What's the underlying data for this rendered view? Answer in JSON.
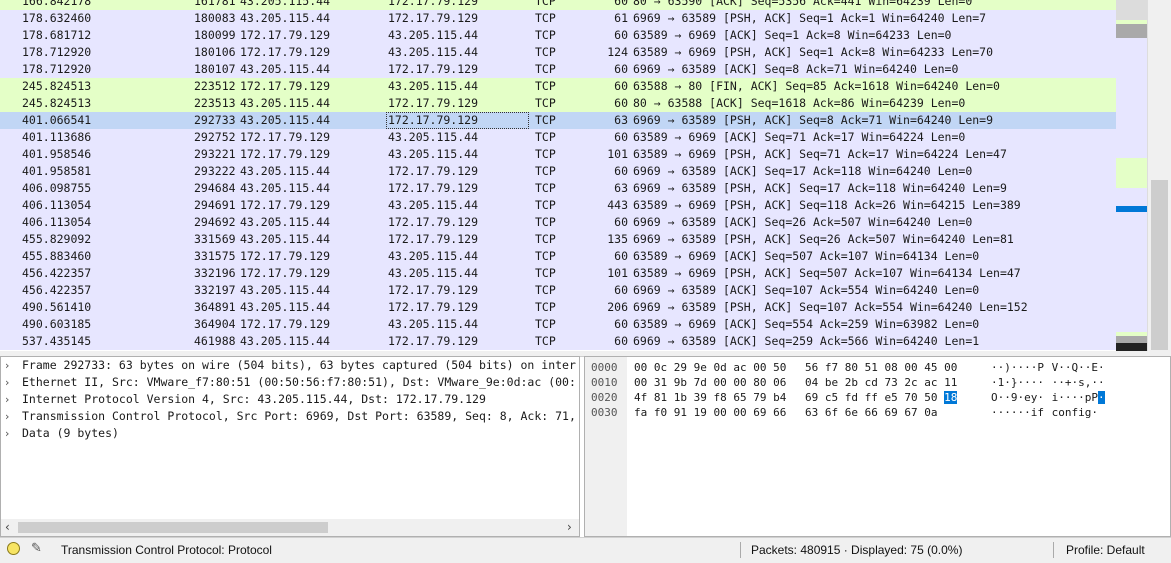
{
  "packet_list": {
    "rows": [
      {
        "time": "166.842178",
        "no": "161781",
        "src": "43.205.115.44",
        "dst": "172.17.79.129",
        "proto": "TCP",
        "len": "60",
        "info": "80 → 63590 [ACK] Seq=5356 Ack=441 Win=64239 Len=0",
        "color": "http"
      },
      {
        "time": "178.632460",
        "no": "180083",
        "src": "43.205.115.44",
        "dst": "172.17.79.129",
        "proto": "TCP",
        "len": "61",
        "info": "6969 → 63589 [PSH, ACK] Seq=1 Ack=1 Win=64240 Len=7",
        "color": "tcp"
      },
      {
        "time": "178.681712",
        "no": "180099",
        "src": "172.17.79.129",
        "dst": "43.205.115.44",
        "proto": "TCP",
        "len": "60",
        "info": "63589 → 6969 [ACK] Seq=1 Ack=8 Win=64233 Len=0",
        "color": "tcp"
      },
      {
        "time": "178.712920",
        "no": "180106",
        "src": "172.17.79.129",
        "dst": "43.205.115.44",
        "proto": "TCP",
        "len": "124",
        "info": "63589 → 6969 [PSH, ACK] Seq=1 Ack=8 Win=64233 Len=70",
        "color": "tcp"
      },
      {
        "time": "178.712920",
        "no": "180107",
        "src": "43.205.115.44",
        "dst": "172.17.79.129",
        "proto": "TCP",
        "len": "60",
        "info": "6969 → 63589 [ACK] Seq=8 Ack=71 Win=64240 Len=0",
        "color": "tcp"
      },
      {
        "time": "245.824513",
        "no": "223512",
        "src": "172.17.79.129",
        "dst": "43.205.115.44",
        "proto": "TCP",
        "len": "60",
        "info": "63588 → 80 [FIN, ACK] Seq=85 Ack=1618 Win=64240 Len=0",
        "color": "http"
      },
      {
        "time": "245.824513",
        "no": "223513",
        "src": "43.205.115.44",
        "dst": "172.17.79.129",
        "proto": "TCP",
        "len": "60",
        "info": "80 → 63588 [ACK] Seq=1618 Ack=86 Win=64239 Len=0",
        "color": "http"
      },
      {
        "time": "401.066541",
        "no": "292733",
        "src": "43.205.115.44",
        "dst": "172.17.79.129",
        "proto": "TCP",
        "len": "63",
        "info": "6969 → 63589 [PSH, ACK] Seq=8 Ack=71 Win=64240 Len=9",
        "color": "sel"
      },
      {
        "time": "401.113686",
        "no": "292752",
        "src": "172.17.79.129",
        "dst": "43.205.115.44",
        "proto": "TCP",
        "len": "60",
        "info": "63589 → 6969 [ACK] Seq=71 Ack=17 Win=64224 Len=0",
        "color": "tcp"
      },
      {
        "time": "401.958546",
        "no": "293221",
        "src": "172.17.79.129",
        "dst": "43.205.115.44",
        "proto": "TCP",
        "len": "101",
        "info": "63589 → 6969 [PSH, ACK] Seq=71 Ack=17 Win=64224 Len=47",
        "color": "tcp"
      },
      {
        "time": "401.958581",
        "no": "293222",
        "src": "43.205.115.44",
        "dst": "172.17.79.129",
        "proto": "TCP",
        "len": "60",
        "info": "6969 → 63589 [ACK] Seq=17 Ack=118 Win=64240 Len=0",
        "color": "tcp"
      },
      {
        "time": "406.098755",
        "no": "294684",
        "src": "43.205.115.44",
        "dst": "172.17.79.129",
        "proto": "TCP",
        "len": "63",
        "info": "6969 → 63589 [PSH, ACK] Seq=17 Ack=118 Win=64240 Len=9",
        "color": "tcp"
      },
      {
        "time": "406.113054",
        "no": "294691",
        "src": "172.17.79.129",
        "dst": "43.205.115.44",
        "proto": "TCP",
        "len": "443",
        "info": "63589 → 6969 [PSH, ACK] Seq=118 Ack=26 Win=64215 Len=389",
        "color": "tcp"
      },
      {
        "time": "406.113054",
        "no": "294692",
        "src": "43.205.115.44",
        "dst": "172.17.79.129",
        "proto": "TCP",
        "len": "60",
        "info": "6969 → 63589 [ACK] Seq=26 Ack=507 Win=64240 Len=0",
        "color": "tcp"
      },
      {
        "time": "455.829092",
        "no": "331569",
        "src": "43.205.115.44",
        "dst": "172.17.79.129",
        "proto": "TCP",
        "len": "135",
        "info": "6969 → 63589 [PSH, ACK] Seq=26 Ack=507 Win=64240 Len=81",
        "color": "tcp"
      },
      {
        "time": "455.883460",
        "no": "331575",
        "src": "172.17.79.129",
        "dst": "43.205.115.44",
        "proto": "TCP",
        "len": "60",
        "info": "63589 → 6969 [ACK] Seq=507 Ack=107 Win=64134 Len=0",
        "color": "tcp"
      },
      {
        "time": "456.422357",
        "no": "332196",
        "src": "172.17.79.129",
        "dst": "43.205.115.44",
        "proto": "TCP",
        "len": "101",
        "info": "63589 → 6969 [PSH, ACK] Seq=507 Ack=107 Win=64134 Len=47",
        "color": "tcp"
      },
      {
        "time": "456.422357",
        "no": "332197",
        "src": "43.205.115.44",
        "dst": "172.17.79.129",
        "proto": "TCP",
        "len": "60",
        "info": "6969 → 63589 [ACK] Seq=107 Ack=554 Win=64240 Len=0",
        "color": "tcp"
      },
      {
        "time": "490.561410",
        "no": "364891",
        "src": "43.205.115.44",
        "dst": "172.17.79.129",
        "proto": "TCP",
        "len": "206",
        "info": "6969 → 63589 [PSH, ACK] Seq=107 Ack=554 Win=64240 Len=152",
        "color": "tcp"
      },
      {
        "time": "490.603185",
        "no": "364904",
        "src": "172.17.79.129",
        "dst": "43.205.115.44",
        "proto": "TCP",
        "len": "60",
        "info": "63589 → 6969 [ACK] Seq=554 Ack=259 Win=63982 Len=0",
        "color": "tcp"
      },
      {
        "time": "537.435145",
        "no": "461988",
        "src": "43.205.115.44",
        "dst": "172.17.79.129",
        "proto": "TCP",
        "len": "60",
        "info": "6969 → 63589 [ACK] Seq=259 Ack=566 Win=64240 Len=1",
        "color": "tcp"
      }
    ]
  },
  "details": {
    "items": [
      "Frame 292733: 63 bytes on wire (504 bits), 63 bytes captured (504 bits) on inter",
      "Ethernet II, Src: VMware_f7:80:51 (00:50:56:f7:80:51), Dst: VMware_9e:0d:ac (00:",
      "Internet Protocol Version 4, Src: 43.205.115.44, Dst: 172.17.79.129",
      "Transmission Control Protocol, Src Port: 6969, Dst Port: 63589, Seq: 8, Ack: 71,",
      "Data (9 bytes)"
    ],
    "expand_glyph": "›",
    "scroll_left": "‹",
    "scroll_right": "›"
  },
  "hex": {
    "rows": [
      {
        "offset": "0000",
        "bytes1": "00 0c 29 9e 0d ac 00 50",
        "bytes2": "56 f7 80 51 08 00 45 00",
        "ascii1": "··)····P",
        "ascii2": " V··Q··E·"
      },
      {
        "offset": "0010",
        "bytes1": "00 31 9b 7d 00 00 80 06",
        "bytes2": "04 be 2b cd 73 2c ac 11",
        "ascii1": "·1·}····",
        "ascii2": " ··+·s,··"
      },
      {
        "offset": "0020",
        "bytes1": "4f 81 1b 39 f8 65 79 b4",
        "bytes2": "69 c5 fd ff e5 70 50",
        "hl_byte": "18",
        "ascii1": "O··9·ey·",
        "ascii2": " i····pP",
        "hl_ascii": "·"
      },
      {
        "offset": "0030",
        "bytes1": "fa f0 91 19 00 00 69 66",
        "bytes2": "63 6f 6e 66 69 67 0a",
        "ascii1": "······if",
        "ascii2": " config·"
      }
    ]
  },
  "statusbar": {
    "field": "Transmission Control Protocol: Protocol",
    "packets": "Packets: 480915 · Displayed: 75 (0.0%)",
    "profile": "Profile: Default",
    "edit_glyph": "✎"
  },
  "colors": {
    "tcp_row": "#e7e6ff",
    "http_row": "#e4ffc7",
    "selected_row": "#c1d6f5",
    "hex_highlight": "#0078d7"
  }
}
